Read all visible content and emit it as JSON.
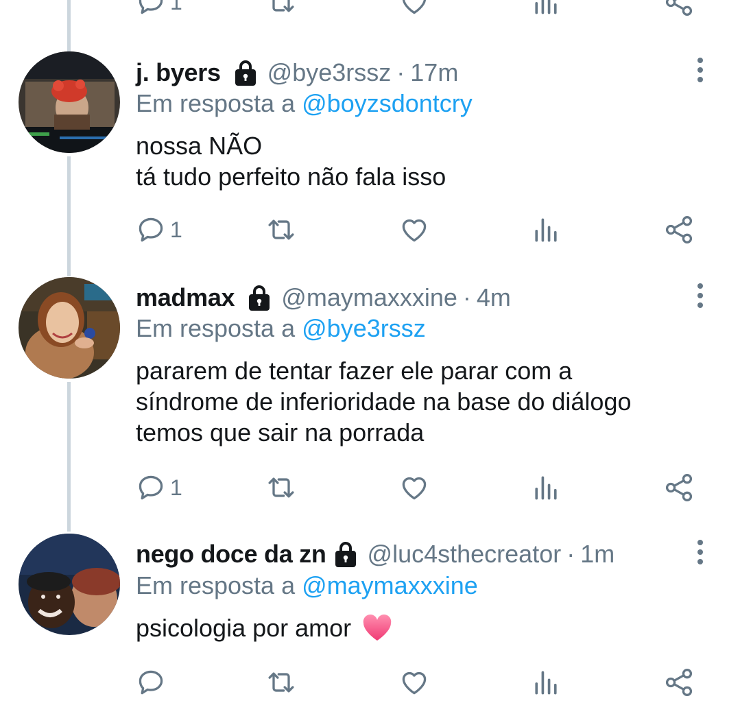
{
  "colors": {
    "link": "#1da1f2",
    "secondary": "#657786",
    "text": "#14171a",
    "thread_line": "#ccd6dd"
  },
  "icons": [
    "lock-icon",
    "more-options-icon",
    "reply-icon",
    "retweet-icon",
    "like-icon",
    "analytics-icon",
    "share-icon",
    "heart-emoji"
  ],
  "top_actions": {
    "reply_count": "1"
  },
  "tweets": [
    {
      "display_name": "j. byers",
      "handle": "@bye3rssz",
      "separator": "·",
      "time": "17m",
      "reply_prefix": "Em resposta a",
      "reply_to": "@boyzsdontcry",
      "lines": [
        "nossa NÃO",
        "tá tudo perfeito não fala isso"
      ],
      "reply_count": "1"
    },
    {
      "display_name": "madmax",
      "handle": "@maymaxxxine",
      "separator": "·",
      "time": "4m",
      "reply_prefix": "Em resposta a",
      "reply_to": "@bye3rssz",
      "lines": [
        "pararem de tentar fazer ele parar com a",
        "síndrome de inferioridade na base do diálogo",
        "temos que sair na porrada"
      ],
      "reply_count": "1"
    },
    {
      "display_name": "nego doce da zn",
      "handle": "@luc4sthecreator",
      "separator": "·",
      "time": "1m",
      "reply_prefix": "Em resposta a",
      "reply_to": "@maymaxxxine",
      "lines": [
        "psicologia por amor"
      ],
      "reply_count": ""
    }
  ]
}
